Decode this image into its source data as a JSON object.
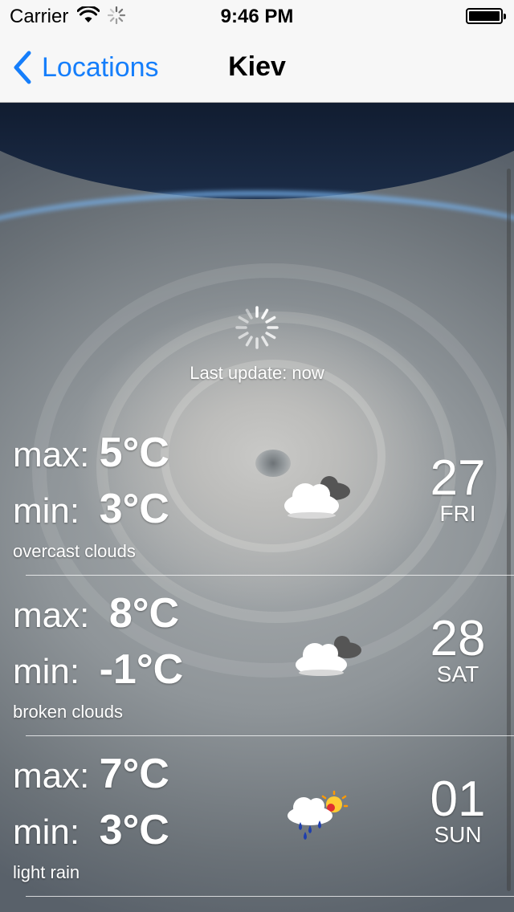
{
  "status_bar": {
    "carrier": "Carrier",
    "time": "9:46 PM"
  },
  "nav": {
    "back_label": "Locations",
    "title": "Kiev"
  },
  "refresh": {
    "last_update": "Last update: now"
  },
  "forecast": [
    {
      "max_label": "max:",
      "max_value": "5°C",
      "min_label": "min:",
      "min_value": "3°C",
      "description": "overcast clouds",
      "icon": "overcast-clouds-icon",
      "day": "27",
      "weekday": "FRI"
    },
    {
      "max_label": "max:",
      "max_value": "8°C",
      "min_label": "min:",
      "min_value": "-1°C",
      "description": "broken clouds",
      "icon": "broken-clouds-icon",
      "day": "28",
      "weekday": "SAT"
    },
    {
      "max_label": "max:",
      "max_value": "7°C",
      "min_label": "min:",
      "min_value": "3°C",
      "description": "light rain",
      "icon": "light-rain-icon",
      "day": "01",
      "weekday": "SUN"
    }
  ],
  "colors": {
    "ios_blue": "#157efb",
    "navbar_bg": "#f7f7f7",
    "text_on_image": "#ffffff"
  }
}
